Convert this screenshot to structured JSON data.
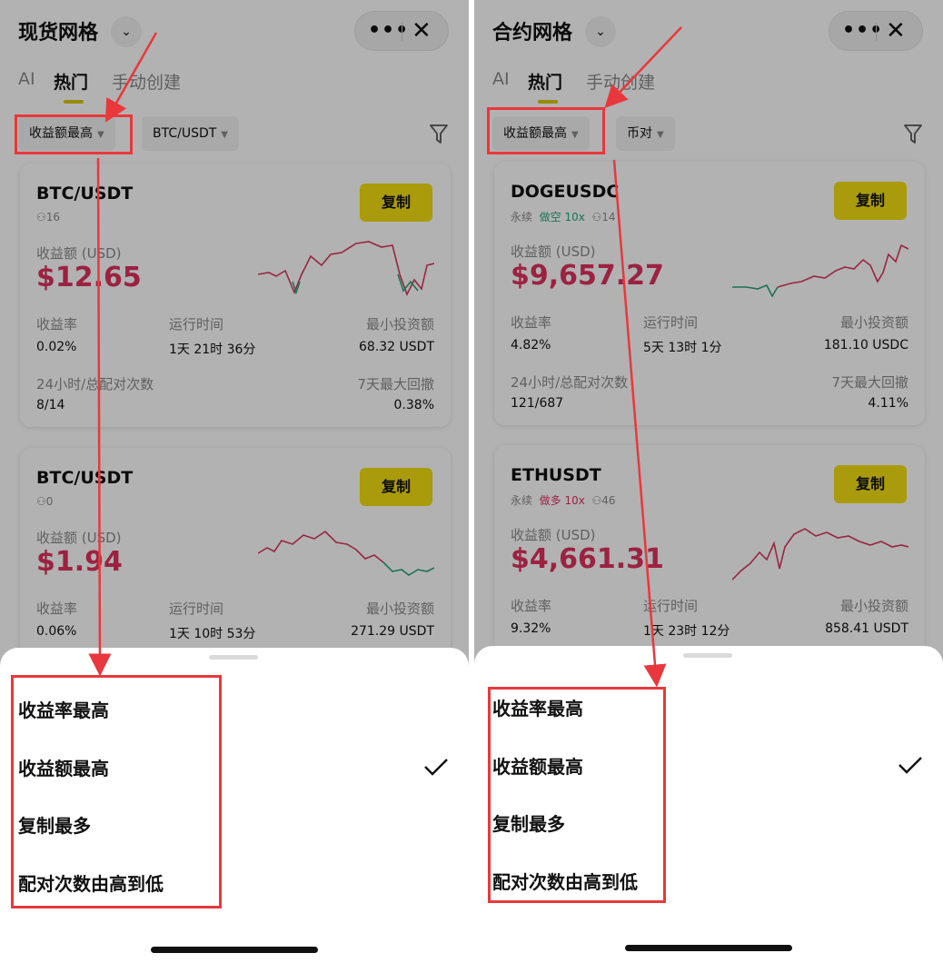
{
  "panels": [
    {
      "header": {
        "title": "现货网格",
        "dropdown_icon": "chevron-down-icon",
        "more_icon": "more-icon",
        "close_icon": "close-icon"
      },
      "tabs": [
        {
          "label": "AI"
        },
        {
          "label": "热门"
        },
        {
          "label": "手动创建"
        }
      ],
      "filters": {
        "sort_label": "收益额最高",
        "pair_label": "BTC/USDT"
      },
      "cards": [
        {
          "pair": "BTC/USDT",
          "tag_days": "hidden",
          "tag_mode": "",
          "tag_lev": "",
          "tag_count": "16",
          "copy_label": "复制",
          "profit_label": "收益额 (USD)",
          "profit_value": "$12.65",
          "metrics": [
            {
              "label": "收益率",
              "value": "0.02%"
            },
            {
              "label": "运行时间",
              "value": "1天 21时 36分"
            },
            {
              "label": "最小投资额",
              "value": "68.32 USDT"
            }
          ],
          "metrics2": [
            {
              "label": "24小时/总配对次数",
              "value": "8/14"
            },
            {
              "label": "7天最大回撤",
              "value": "0.38%"
            }
          ]
        },
        {
          "pair": "BTC/USDT",
          "tag_days": "hidden",
          "tag_mode": "",
          "tag_lev": "",
          "tag_count": "0",
          "copy_label": "复制",
          "profit_label": "收益额 (USD)",
          "profit_value": "$1.94",
          "metrics": [
            {
              "label": "收益率",
              "value": "0.06%"
            },
            {
              "label": "运行时间",
              "value": "1天 10时 53分"
            },
            {
              "label": "最小投资额",
              "value": "271.29 USDT"
            }
          ]
        }
      ],
      "sheet": {
        "options": [
          "收益率最高",
          "收益额最高",
          "复制最多",
          "配对次数由高到低"
        ],
        "selected_index": 1
      }
    },
    {
      "header": {
        "title": "合约网格",
        "dropdown_icon": "chevron-down-icon",
        "more_icon": "more-icon",
        "close_icon": "close-icon"
      },
      "tabs": [
        {
          "label": "AI"
        },
        {
          "label": "热门"
        },
        {
          "label": "手动创建"
        }
      ],
      "filters": {
        "sort_label": "收益额最高",
        "pair_label": "币对"
      },
      "cards": [
        {
          "pair": "DOGEUSDC",
          "tag_perp": "永续",
          "tag_mode": "做空 10x",
          "tag_count": "14",
          "copy_label": "复制",
          "profit_label": "收益额 (USD)",
          "profit_value": "$9,657.27",
          "metrics": [
            {
              "label": "收益率",
              "value": "4.82%"
            },
            {
              "label": "运行时间",
              "value": "5天 13时 1分"
            },
            {
              "label": "最小投资额",
              "value": "181.10 USDC"
            }
          ],
          "metrics2": [
            {
              "label": "24小时/总配对次数",
              "value": "121/687"
            },
            {
              "label": "7天最大回撤",
              "value": "4.11%"
            }
          ]
        },
        {
          "pair": "ETHUSDT",
          "tag_perp": "永续",
          "tag_mode": "做多 10x",
          "tag_count": "46",
          "copy_label": "复制",
          "profit_label": "收益额 (USD)",
          "profit_value": "$4,661.31",
          "metrics": [
            {
              "label": "收益率",
              "value": "9.32%"
            },
            {
              "label": "运行时间",
              "value": "1天 23时 12分"
            },
            {
              "label": "最小投资额",
              "value": "858.41 USDT"
            }
          ]
        }
      ],
      "sheet": {
        "options": [
          "收益率最高",
          "收益额最高",
          "复制最多",
          "配对次数由高到低"
        ],
        "selected_index": 1
      }
    }
  ],
  "colors": {
    "accent_yellow": "#f2de10",
    "profit_red": "#e0325f",
    "short_green": "#2ba37d",
    "annotation_red": "#e8383d"
  }
}
